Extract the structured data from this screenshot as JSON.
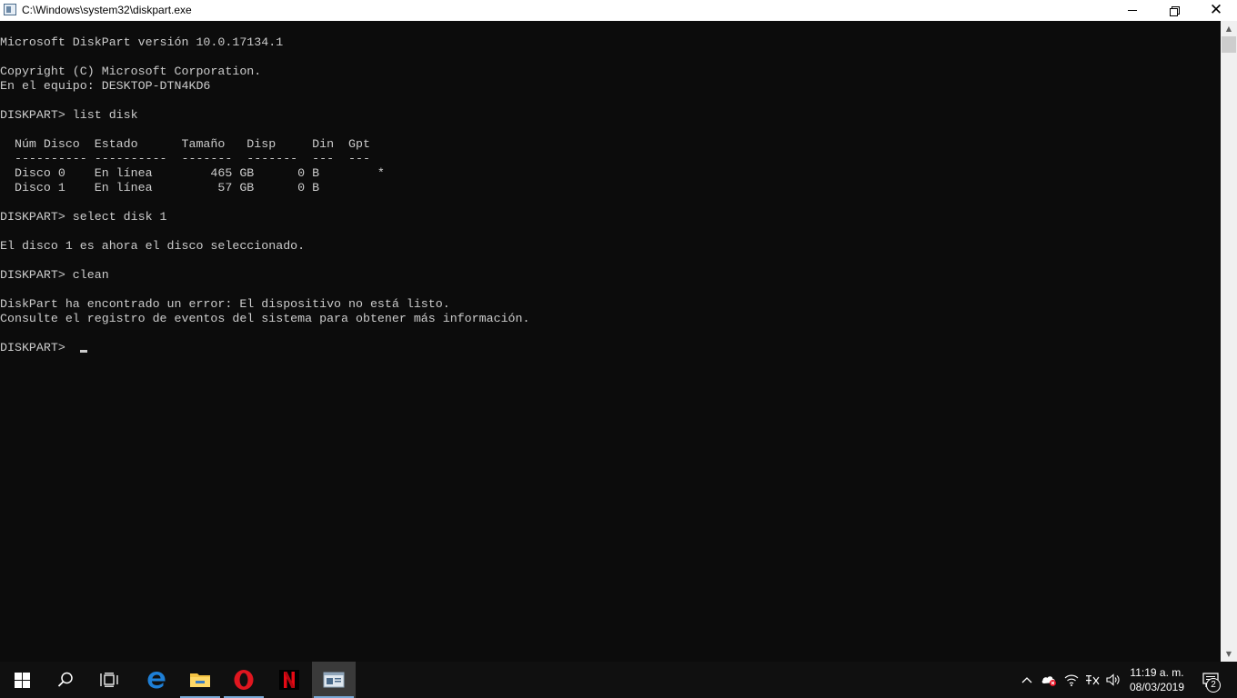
{
  "window": {
    "title": "C:\\Windows\\system32\\diskpart.exe",
    "minimize_label": "Minimize",
    "maximize_label": "Restore Down",
    "close_label": "Close"
  },
  "console": {
    "lines": [
      "Microsoft DiskPart versión 10.0.17134.1",
      "",
      "Copyright (C) Microsoft Corporation.",
      "En el equipo: DESKTOP-DTN4KD6",
      "",
      "DISKPART> list disk",
      "",
      "  Núm Disco  Estado      Tamaño   Disp     Din  Gpt",
      "  ---------- ----------  -------  -------  ---  ---",
      "  Disco 0    En línea        465 GB      0 B        *",
      "  Disco 1    En línea         57 GB      0 B",
      "",
      "DISKPART> select disk 1",
      "",
      "El disco 1 es ahora el disco seleccionado.",
      "",
      "DISKPART> clean",
      "",
      "DiskPart ha encontrado un error: El dispositivo no está listo.",
      "Consulte el registro de eventos del sistema para obtener más información.",
      "",
      "DISKPART> "
    ],
    "text_color": "#cccccc",
    "background": "#0c0c0c"
  },
  "taskbar": {
    "clock_time": "11:19 a. m.",
    "clock_date": "08/03/2019",
    "notification_count": "2",
    "items": [
      {
        "name": "start-button",
        "icon": "windows-logo-icon"
      },
      {
        "name": "search-button",
        "icon": "search-icon"
      },
      {
        "name": "task-view-button",
        "icon": "task-view-icon"
      },
      {
        "name": "edge-button",
        "icon": "edge-icon"
      },
      {
        "name": "file-explorer-button",
        "icon": "folder-icon"
      },
      {
        "name": "opera-button",
        "icon": "opera-icon"
      },
      {
        "name": "netflix-button",
        "icon": "netflix-icon"
      },
      {
        "name": "diskpart-button",
        "icon": "console-window-icon"
      }
    ],
    "tray": [
      "chevron-up-icon",
      "onedrive-error-icon",
      "wifi-icon",
      "input-indicator-icon",
      "volume-icon"
    ]
  },
  "colors": {
    "taskbar_bg": "#101010",
    "active_item_bg": "#3a3a3a",
    "edge_blue": "#1e7fd6",
    "folder_yellow": "#f4c343",
    "opera_red": "#e0161f",
    "netflix_red": "#e50914"
  }
}
